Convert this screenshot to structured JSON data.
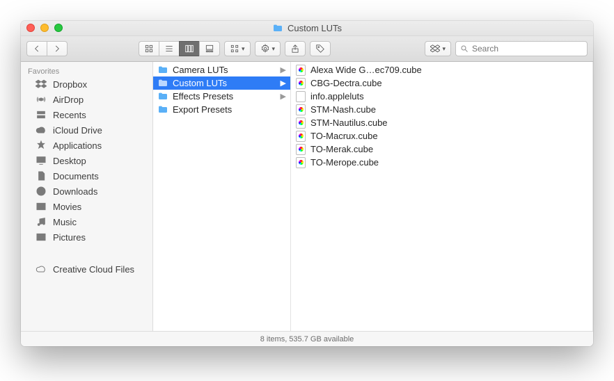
{
  "window": {
    "title": "Custom LUTs"
  },
  "toolbar": {
    "search_placeholder": "Search"
  },
  "sidebar": {
    "header": "Favorites",
    "items": [
      {
        "label": "Dropbox",
        "icon": "dropbox"
      },
      {
        "label": "AirDrop",
        "icon": "airdrop"
      },
      {
        "label": "Recents",
        "icon": "recents"
      },
      {
        "label": "iCloud Drive",
        "icon": "cloud"
      },
      {
        "label": "Applications",
        "icon": "apps"
      },
      {
        "label": "Desktop",
        "icon": "desktop"
      },
      {
        "label": "Documents",
        "icon": "documents"
      },
      {
        "label": "Downloads",
        "icon": "downloads"
      },
      {
        "label": "Movies",
        "icon": "movies"
      },
      {
        "label": "Music",
        "icon": "music"
      },
      {
        "label": "Pictures",
        "icon": "pictures"
      }
    ],
    "extra": {
      "label": "Creative Cloud Files",
      "icon": "cc"
    }
  },
  "column1": {
    "items": [
      {
        "label": "Camera LUTs",
        "type": "folder",
        "expandable": true,
        "selected": false
      },
      {
        "label": "Custom LUTs",
        "type": "folder",
        "expandable": true,
        "selected": true
      },
      {
        "label": "Effects Presets",
        "type": "folder",
        "expandable": true,
        "selected": false
      },
      {
        "label": "Export Presets",
        "type": "folder",
        "expandable": false,
        "selected": false
      }
    ]
  },
  "column2": {
    "items": [
      {
        "label": "Alexa Wide G…ec709.cube",
        "type": "cube"
      },
      {
        "label": "CBG-Dectra.cube",
        "type": "cube"
      },
      {
        "label": "info.appleluts",
        "type": "plain"
      },
      {
        "label": "STM-Nash.cube",
        "type": "cube"
      },
      {
        "label": "STM-Nautilus.cube",
        "type": "cube"
      },
      {
        "label": "TO-Macrux.cube",
        "type": "cube"
      },
      {
        "label": "TO-Merak.cube",
        "type": "cube"
      },
      {
        "label": "TO-Merope.cube",
        "type": "cube"
      }
    ]
  },
  "status": {
    "text": "8 items, 535.7 GB available"
  }
}
